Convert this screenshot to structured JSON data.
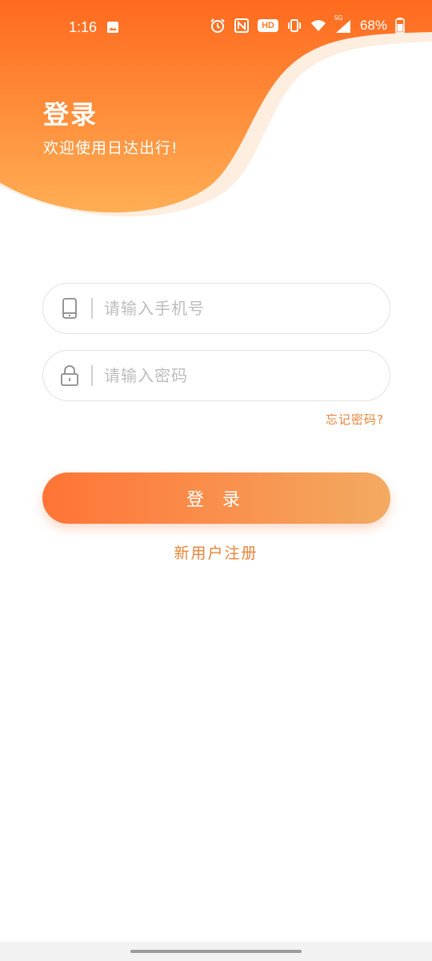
{
  "status_bar": {
    "time": "1:16",
    "hd_badge": "HD",
    "network": "5G",
    "battery": "68%",
    "icons": [
      "image-icon",
      "alarm-icon",
      "nfc-icon",
      "vibrate-icon",
      "wifi-icon",
      "signal-icon",
      "battery-icon"
    ]
  },
  "header": {
    "title": "登录",
    "subtitle": "欢迎使用日达出行!"
  },
  "form": {
    "phone_placeholder": "请输入手机号",
    "password_placeholder": "请输入密码",
    "forgot_password": "忘记密码?",
    "login_button": "登 录",
    "register_link": "新用户注册"
  },
  "colors": {
    "accent_start": "#ff7436",
    "accent_end": "#f3aa62",
    "link": "#e8843a"
  }
}
